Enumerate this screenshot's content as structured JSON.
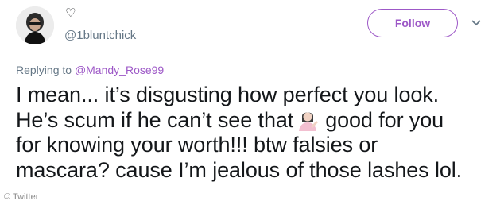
{
  "tweet": {
    "display_name": "♡",
    "handle": "@1bluntchick",
    "follow_label": "Follow",
    "replying_prefix": "Replying to ",
    "replying_to": "@Mandy_Rose99",
    "text_lines": [
      "I mean... it’s disgusting how perfect you look.",
      "He’s scum if he can’t see that",
      "good for you",
      "for knowing your worth!!! btw falsies or",
      "mascara? cause I’m jealous of those lashes lol."
    ],
    "emoji": "person-tipping-hand-emoji"
  },
  "colors": {
    "accent": "#9d58c7",
    "text": "#14171a",
    "muted": "#657786"
  },
  "watermark": "© Twitter"
}
